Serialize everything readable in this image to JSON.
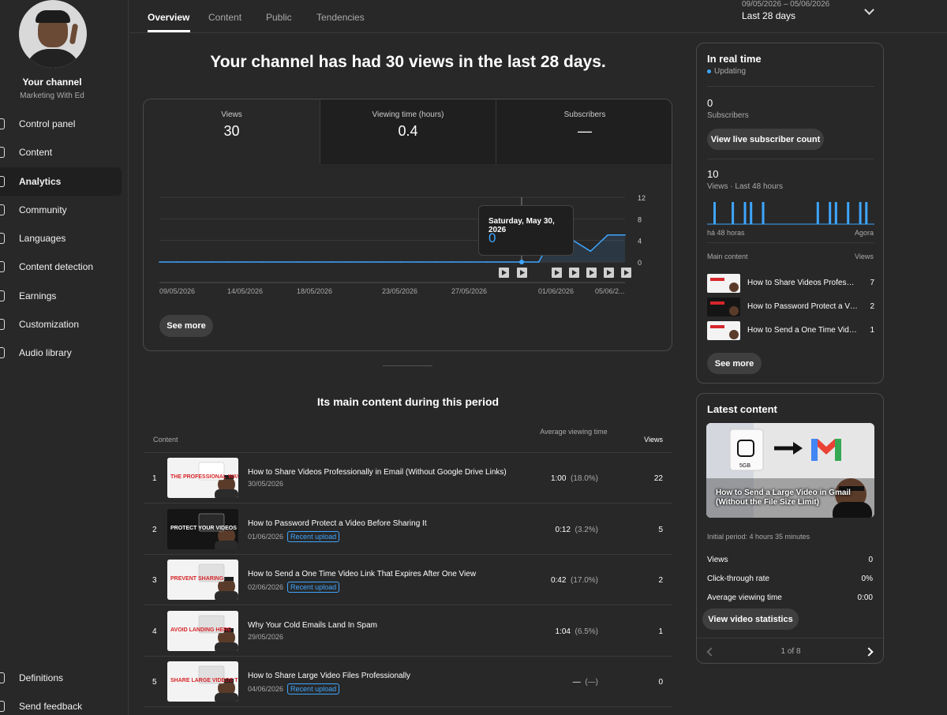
{
  "channel": {
    "title": "Your channel",
    "subtitle": "Marketing With Ed"
  },
  "sidebar": {
    "items": [
      {
        "label": "Control panel",
        "icon": "dashboard-icon"
      },
      {
        "label": "Content",
        "icon": "content-icon"
      },
      {
        "label": "Analytics",
        "icon": "analytics-icon",
        "active": true
      },
      {
        "label": "Community",
        "icon": "community-icon"
      },
      {
        "label": "Languages",
        "icon": "languages-icon"
      },
      {
        "label": "Content detection",
        "icon": "copyright-icon"
      },
      {
        "label": "Earnings",
        "icon": "earnings-icon"
      },
      {
        "label": "Customization",
        "icon": "customization-icon"
      },
      {
        "label": "Audio library",
        "icon": "audio-icon"
      }
    ],
    "bottom": [
      {
        "label": "Definitions",
        "icon": "settings-icon"
      },
      {
        "label": "Send feedback",
        "icon": "feedback-icon"
      }
    ]
  },
  "tabs": [
    "Overview",
    "Content",
    "Public",
    "Tendencies"
  ],
  "daterange": {
    "range": "09/05/2026 – 05/06/2026",
    "label": "Last 28 days"
  },
  "headline": "Your channel has had 30 views in the last 28 days.",
  "metrics": [
    {
      "label": "Views",
      "value": "30"
    },
    {
      "label": "Viewing time (hours)",
      "value": "0.4"
    },
    {
      "label": "Subscribers",
      "value": "—"
    }
  ],
  "chart_data": {
    "type": "line",
    "x": [
      "09/05/2026",
      "14/05/2026",
      "18/05/2026",
      "23/05/2026",
      "27/05/2026",
      "01/06/2026",
      "05/06/2..."
    ],
    "x_tick_labels": [
      "09/05/2026",
      "14/05/2026",
      "18/05/2026",
      "23/05/2026",
      "27/05/2026",
      "01/06/2026",
      "05/06/2..."
    ],
    "y_tick_labels": [
      "12",
      "8",
      "4",
      "0"
    ],
    "ylim": [
      0,
      12
    ],
    "series": [
      {
        "values": [
          0,
          0,
          0,
          0,
          0,
          0,
          0,
          0,
          0,
          0,
          0,
          0,
          0,
          0,
          0,
          0,
          0,
          0,
          0,
          0,
          0,
          0,
          0,
          6,
          4,
          2,
          5,
          5
        ]
      }
    ],
    "tooltip": {
      "date": "Saturday, May 30, 2026",
      "value": "0"
    }
  },
  "see_more": "See more",
  "section_title": "Its main content during this period",
  "table": {
    "headers": {
      "content": "Content",
      "avg": "Average viewing time",
      "views": "Views"
    },
    "rows": [
      {
        "rank": "1",
        "title": "How to Share Videos Professionally in Email (Without Google Drive Links)",
        "date": "30/05/2026",
        "badge": "",
        "avg": "1:00",
        "pct": "(18.0%)",
        "views": "22"
      },
      {
        "rank": "2",
        "title": "How to Password Protect a Video Before Sharing It",
        "date": "01/06/2026",
        "badge": "Recent upload",
        "avg": "0:12",
        "pct": "(3.2%)",
        "views": "5"
      },
      {
        "rank": "3",
        "title": "How to Send a One Time Video Link That Expires After One View",
        "date": "02/06/2026",
        "badge": "Recent upload",
        "avg": "0:42",
        "pct": "(17.0%)",
        "views": "2"
      },
      {
        "rank": "4",
        "title": "Why Your Cold Emails Land In Spam",
        "date": "29/05/2026",
        "badge": "",
        "avg": "1:04",
        "pct": "(6.5%)",
        "views": "1"
      },
      {
        "rank": "5",
        "title": "How to Share Large Video Files Professionally",
        "date": "04/06/2026",
        "badge": "Recent upload",
        "avg": "—",
        "pct": "(—)",
        "views": "0"
      }
    ]
  },
  "thumbs": [
    {
      "text": "THE PROFESSIONAL WAY",
      "bg": "#f3f3f3",
      "fg": "#d6262a"
    },
    {
      "text": "PROTECT YOUR VIDEOS",
      "bg": "#151515",
      "fg": "#ffffff"
    },
    {
      "text": "PREVENT SHARING",
      "bg": "#f3f3f3",
      "fg": "#d6262a"
    },
    {
      "text": "AVOID LANDING HERE",
      "bg": "#f3f3f3",
      "fg": "#d6262a"
    },
    {
      "text": "SHARE LARGE VIDEOS THE RIGHT WAY",
      "bg": "#f3f3f3",
      "fg": "#d6262a"
    }
  ],
  "realtime": {
    "title": "In real time",
    "updating": "Updating",
    "subs_value": "0",
    "subs_label": "Subscribers",
    "live_button": "View live subscriber count",
    "views_value": "10",
    "views_label": "Views · Last 48 hours",
    "axis_left": "há 48 horas",
    "axis_right": "Agora",
    "bars": [
      1,
      0,
      0,
      1,
      0,
      1,
      1,
      0,
      1,
      0,
      0,
      0,
      0,
      0,
      0,
      0,
      0,
      1,
      0,
      1,
      1,
      0,
      1,
      0,
      1,
      1
    ],
    "list_header_left": "Main content",
    "list_header_right": "Views",
    "list": [
      {
        "title": "How to Share Videos Professionally in Email (Without Google Drive Links)",
        "views": "7"
      },
      {
        "title": "How to Password Protect a Video Before Sharing It",
        "views": "2"
      },
      {
        "title": "How to Send a One Time Video Link That Expires After One View",
        "views": "1"
      }
    ],
    "see_more": "See more"
  },
  "latest": {
    "title": "Latest content",
    "video_title": "How to Send a Large Video in Gmail (Without the File Size Limit)",
    "thumb_badge": "5GB",
    "initial": "Initial period: 4 hours 35 minutes",
    "stats": [
      {
        "label": "Views",
        "value": "0"
      },
      {
        "label": "Click-through rate",
        "value": "0%"
      },
      {
        "label": "Average viewing time",
        "value": "0:00"
      }
    ],
    "button": "View video statistics",
    "pager": "1 of 8"
  },
  "colors": {
    "accent": "#3ea6ff",
    "bg": "#282828",
    "panel": "#1f1f1f"
  }
}
